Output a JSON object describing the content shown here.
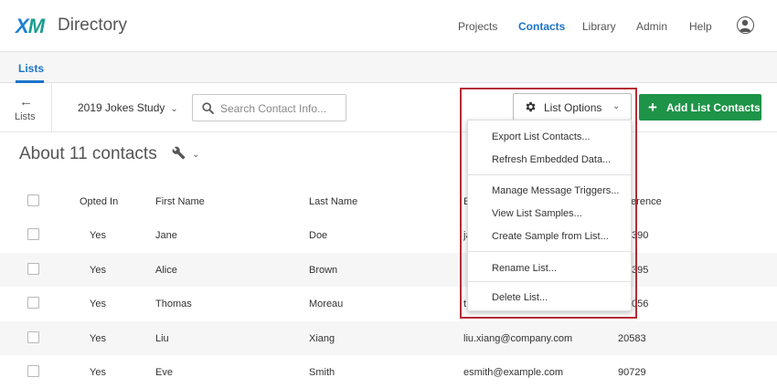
{
  "nav": {
    "logo_x": "X",
    "logo_m": "M",
    "product": "Directory",
    "items": [
      "Projects",
      "Contacts",
      "Library",
      "Admin",
      "Help"
    ],
    "active": "Contacts"
  },
  "subnav": {
    "tab": "Lists"
  },
  "toolbar": {
    "back_label": "Lists",
    "list_name": "2019 Jokes Study",
    "search_placeholder": "Search Contact Info...",
    "list_options_label": "List Options",
    "add_button_label": "Add List Contacts"
  },
  "contacts": {
    "title": "About 11 contacts"
  },
  "table": {
    "headers": [
      "Opted In",
      "First Name",
      "Last Name",
      "E",
      "ference"
    ],
    "rows": [
      [
        "Yes",
        "Jane",
        "Doe",
        "ja",
        "390"
      ],
      [
        "Yes",
        "Alice",
        "Brown",
        "",
        "395"
      ],
      [
        "Yes",
        "Thomas",
        "Moreau",
        "t",
        "056"
      ],
      [
        "Yes",
        "Liu",
        "Xiang",
        "liu.xiang@company.com",
        "20583"
      ],
      [
        "Yes",
        "Eve",
        "Smith",
        "esmith@example.com",
        "90729"
      ]
    ]
  },
  "menu": {
    "items": [
      "Export List Contacts...",
      "Refresh Embedded Data...",
      "Manage Message Triggers...",
      "View List Samples...",
      "Create Sample from List...",
      "Rename List...",
      "Delete List..."
    ]
  },
  "colors": {
    "accent": "#1b74c9",
    "add_button": "#1e9448",
    "highlight": "#b52b38"
  }
}
